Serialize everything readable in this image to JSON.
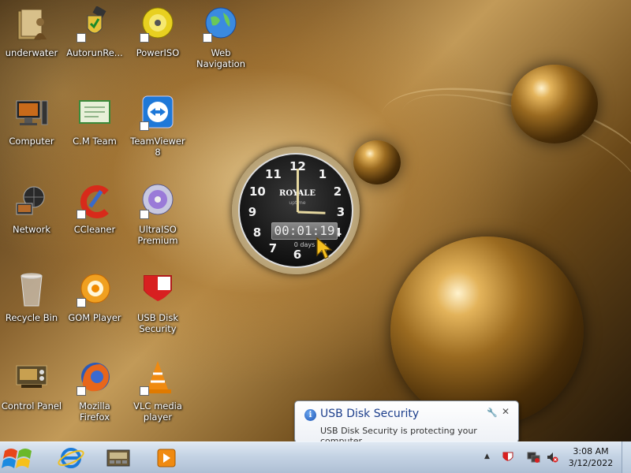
{
  "desktop_icons": [
    {
      "label": "underwater",
      "icon": "folder-person-icon"
    },
    {
      "label": "AutorunRe...",
      "icon": "autorun-shield-icon"
    },
    {
      "label": "PowerISO",
      "icon": "poweriso-disc-icon"
    },
    {
      "label": "Web Navigation",
      "icon": "globe-icon"
    },
    {
      "label": "Computer",
      "icon": "computer-icon"
    },
    {
      "label": "C.M Team",
      "icon": "certificate-icon"
    },
    {
      "label": "TeamViewer 8",
      "icon": "teamviewer-icon"
    },
    {
      "label": "Network",
      "icon": "network-icon"
    },
    {
      "label": "CCleaner",
      "icon": "ccleaner-icon"
    },
    {
      "label": "UltraISO Premium",
      "icon": "ultraiso-disc-icon"
    },
    {
      "label": "Recycle Bin",
      "icon": "recycle-bin-icon"
    },
    {
      "label": "GOM Player",
      "icon": "gom-player-icon"
    },
    {
      "label": "USB Disk Security",
      "icon": "usb-shield-icon"
    },
    {
      "label": "Control Panel",
      "icon": "control-panel-icon"
    },
    {
      "label": "Mozilla Firefox",
      "icon": "firefox-icon"
    },
    {
      "label": "VLC media player",
      "icon": "vlc-cone-icon"
    }
  ],
  "clock_gadget": {
    "brand": "ROYALE",
    "sub": "uptime",
    "timer": "00:01:19",
    "days": "0 days",
    "numbers": [
      "12",
      "1",
      "2",
      "3",
      "4",
      "5",
      "6",
      "7",
      "8",
      "9",
      "10",
      "11"
    ]
  },
  "notification": {
    "title": "USB Disk Security",
    "body": "USB Disk Security is protecting your computer",
    "info_glyph": "i",
    "close_glyph": "✕",
    "wrench_glyph": "🔧"
  },
  "taskbar": {
    "pinned": [
      "internet-explorer-icon",
      "file-manager-icon",
      "media-player-icon"
    ],
    "tray_arrow": "▲",
    "tray": [
      "usb-security-tray-icon",
      "network-tray-icon",
      "volume-muted-icon"
    ],
    "time": "3:08 AM",
    "date": "3/12/2022"
  },
  "colors": {
    "taskbar": "#c4d3e4",
    "balloon_title": "#1d3f8c"
  }
}
